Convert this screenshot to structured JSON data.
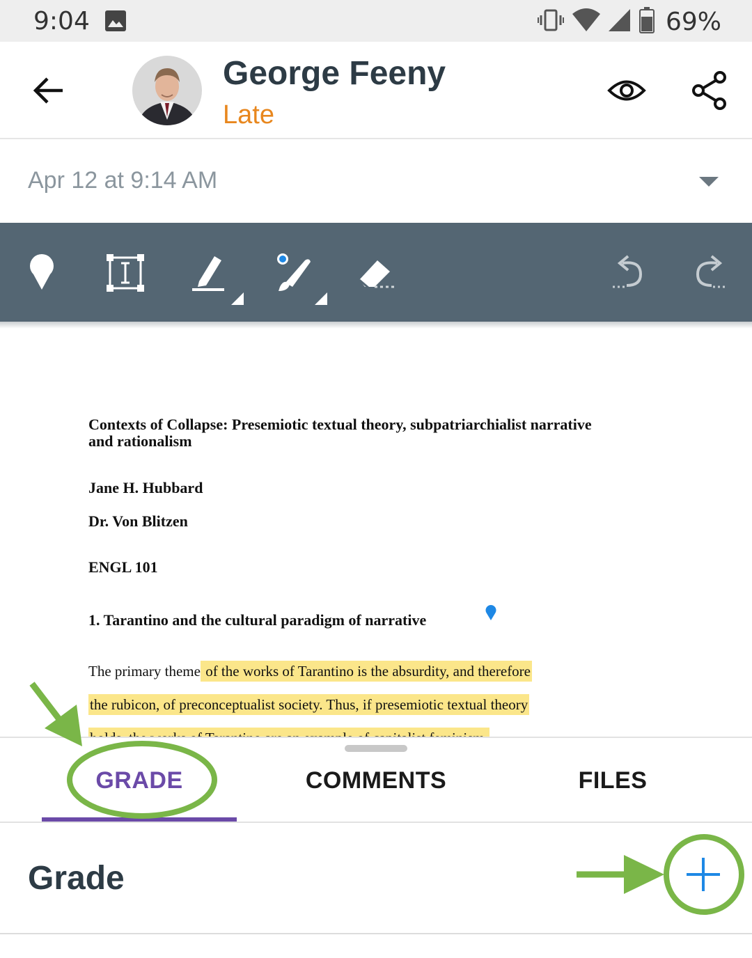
{
  "status_bar": {
    "time": "9:04",
    "battery": "69%",
    "icons": [
      "photo-icon",
      "vibrate-icon",
      "wifi-icon",
      "signal-icon",
      "battery-icon"
    ]
  },
  "header": {
    "student_name": "George Feeny",
    "submission_status": "Late",
    "icons": [
      "back-arrow-icon",
      "eye-icon",
      "share-icon"
    ]
  },
  "submission": {
    "date": "Apr 12 at 9:14 AM"
  },
  "toolbar": {
    "tools": [
      "pin-icon",
      "text-box-icon",
      "highlighter-icon",
      "brush-icon",
      "eraser-icon",
      "undo-icon",
      "redo-icon"
    ]
  },
  "document": {
    "title": "Contexts of Collapse: Presemiotic textual theory, subpatriarchialist narrative and rationalism",
    "author": "Jane H. Hubbard",
    "instructor": "Dr. Von Blitzen",
    "course": "ENGL 101",
    "heading": "1. Tarantino and the cultural paradigm of narrative",
    "line1_plain": "The primary theme",
    "line1_highlight": " of the works of Tarantino is the absurdity, and therefore",
    "line2_highlight": "the rubicon, of preconceptualist society. Thus, if presemiotic textual theory",
    "line3_highlight": "holds, the works of Tarantino are an example of capitalist feminism."
  },
  "tabs": {
    "grade": "GRADE",
    "comments": "COMMENTS",
    "files": "FILES",
    "active": "GRADE"
  },
  "grade_panel": {
    "label": "Grade"
  },
  "colors": {
    "accent_purple": "#6b4aa8",
    "late_orange": "#e8871e",
    "toolbar_bg": "#546673",
    "highlight_yellow": "#fbe68a",
    "annotation_green": "#7ab648",
    "add_blue": "#1e88e5"
  }
}
